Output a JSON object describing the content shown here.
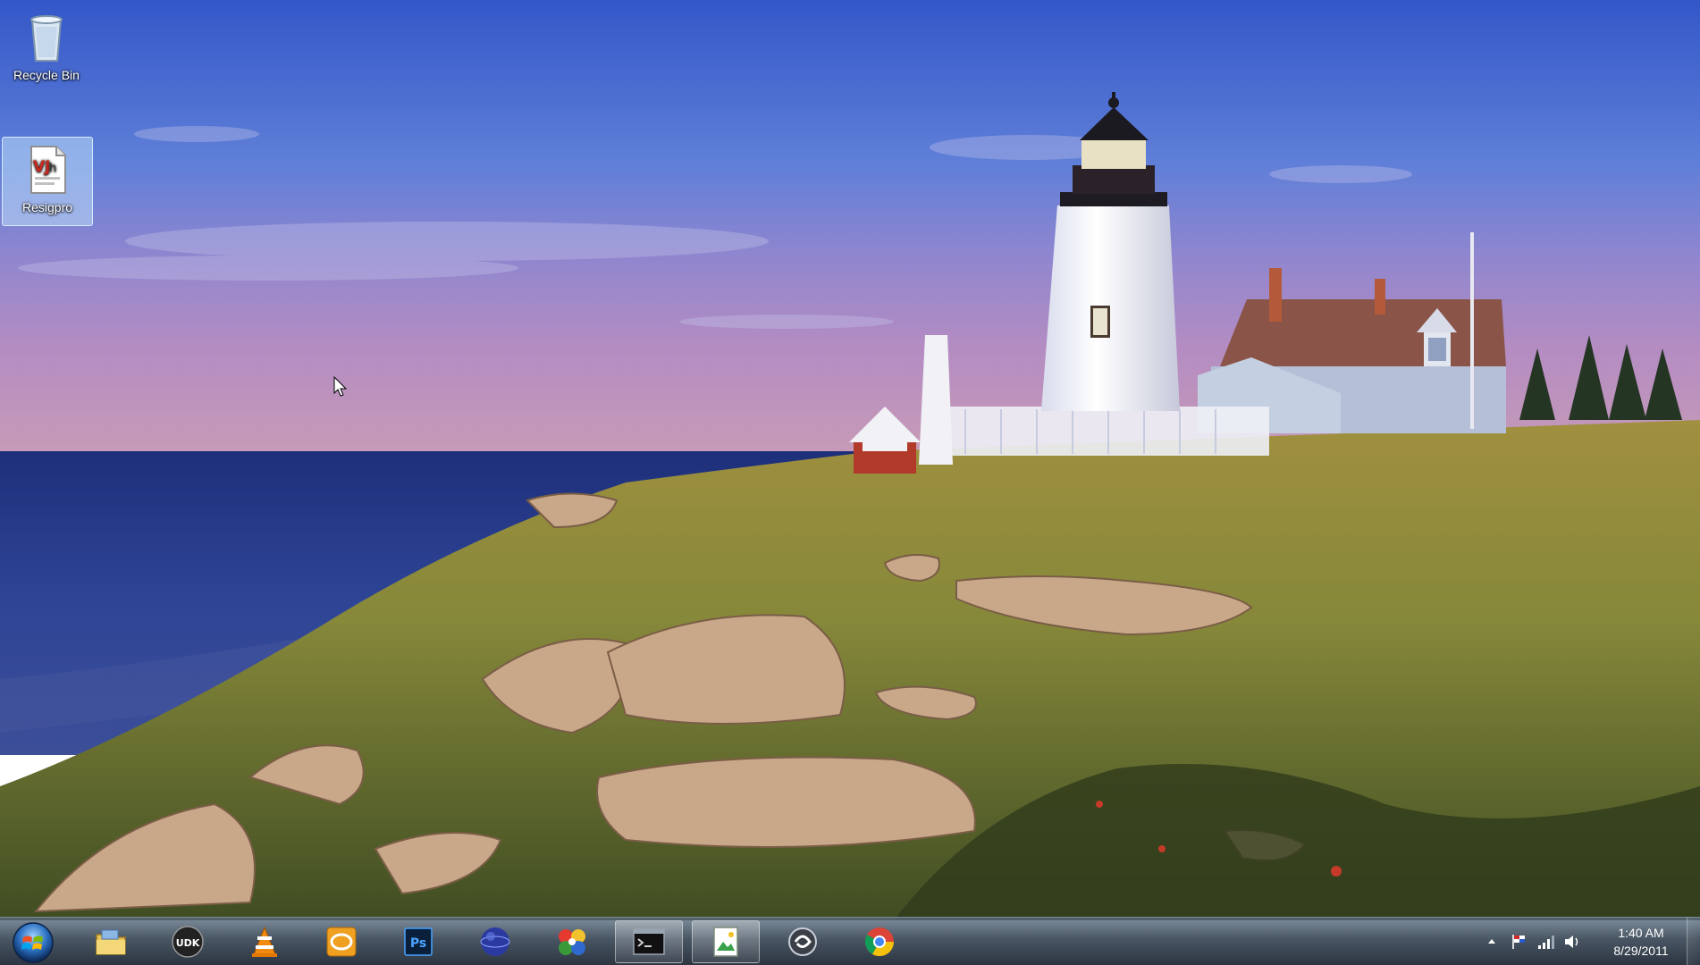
{
  "desktop": {
    "wallpaper": "lighthouse-coast",
    "icons": [
      {
        "label": "Recycle Bin",
        "icon": "recycle-bin-icon"
      },
      {
        "label": "Resigpro",
        "icon": "document-icon"
      }
    ]
  },
  "taskbar": {
    "start": {
      "icon": "windows-orb-icon"
    },
    "items": [
      {
        "icon": "file-explorer-icon",
        "active": false
      },
      {
        "icon": "udk-icon",
        "text": "UDK",
        "active": false
      },
      {
        "icon": "vlc-icon",
        "active": false
      },
      {
        "icon": "orange-app-icon",
        "active": false
      },
      {
        "icon": "photoshop-icon",
        "text": "Ps",
        "active": false
      },
      {
        "icon": "globe-icon",
        "active": false
      },
      {
        "icon": "pinwheel-icon",
        "active": false
      },
      {
        "icon": "command-prompt-icon",
        "active": true
      },
      {
        "icon": "image-editor-icon",
        "active": true
      },
      {
        "icon": "swirl-app-icon",
        "active": false
      },
      {
        "icon": "chrome-icon",
        "active": false
      }
    ],
    "tray": {
      "icons": [
        "show-hidden-icons-icon",
        "action-center-flag-icon",
        "network-signal-icon",
        "volume-icon"
      ],
      "time": "1:40 AM",
      "date": "8/29/2011"
    }
  },
  "colors": {
    "sky_top": "#3b5ec8",
    "sky_bottom": "#a88cc8",
    "sea": "#2a3f86",
    "grass": "#7a8a3a",
    "taskbar": "#2a3b4e"
  }
}
